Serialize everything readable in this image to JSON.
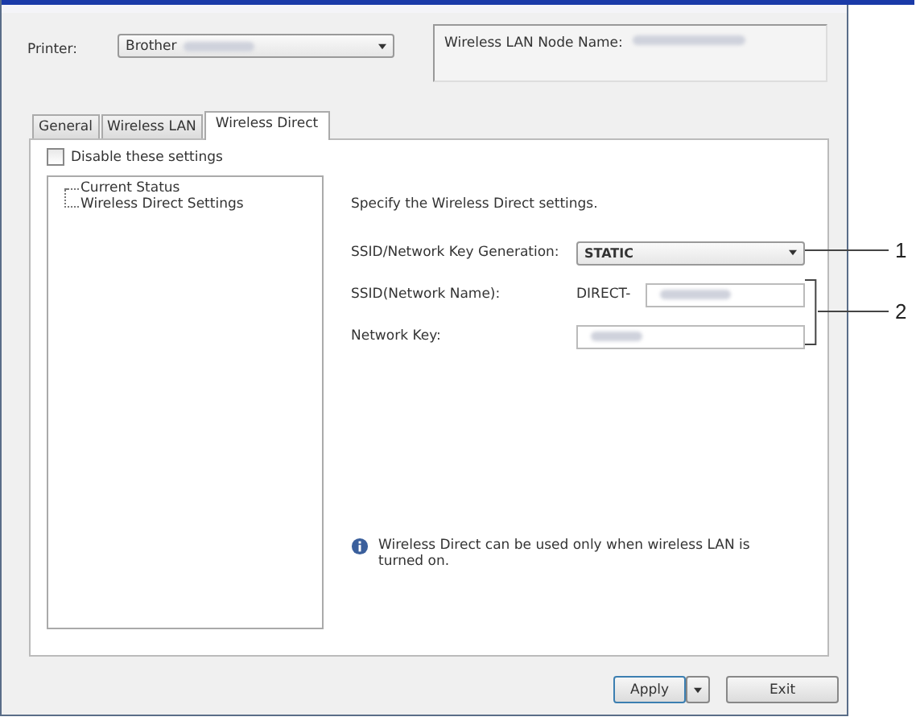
{
  "printer": {
    "label": "Printer:",
    "value": "Brother"
  },
  "node_name": {
    "label": "Wireless LAN Node Name:"
  },
  "tabs": [
    {
      "label": "General",
      "selected": false
    },
    {
      "label": "Wireless LAN",
      "selected": false
    },
    {
      "label": "Wireless Direct",
      "selected": true
    }
  ],
  "disable_settings": {
    "label": "Disable these settings",
    "checked": false
  },
  "tree": [
    {
      "label": "Current Status",
      "selected": false
    },
    {
      "label": "Wireless Direct Settings",
      "selected": false
    }
  ],
  "intro": "Specify the Wireless Direct settings.",
  "fields": [
    {
      "kind": "dropdown",
      "label": "SSID/Network Key Generation:",
      "value": "STATIC"
    },
    {
      "kind": "prefixed",
      "label": "SSID(Network Name):",
      "prefix": "DIRECT-"
    },
    {
      "kind": "text",
      "label": "Network Key:"
    }
  ],
  "note": "Wireless Direct can be used only when wireless LAN is turned on.",
  "buttons": {
    "apply": "Apply",
    "exit": "Exit"
  },
  "callouts": [
    "1",
    "2"
  ]
}
